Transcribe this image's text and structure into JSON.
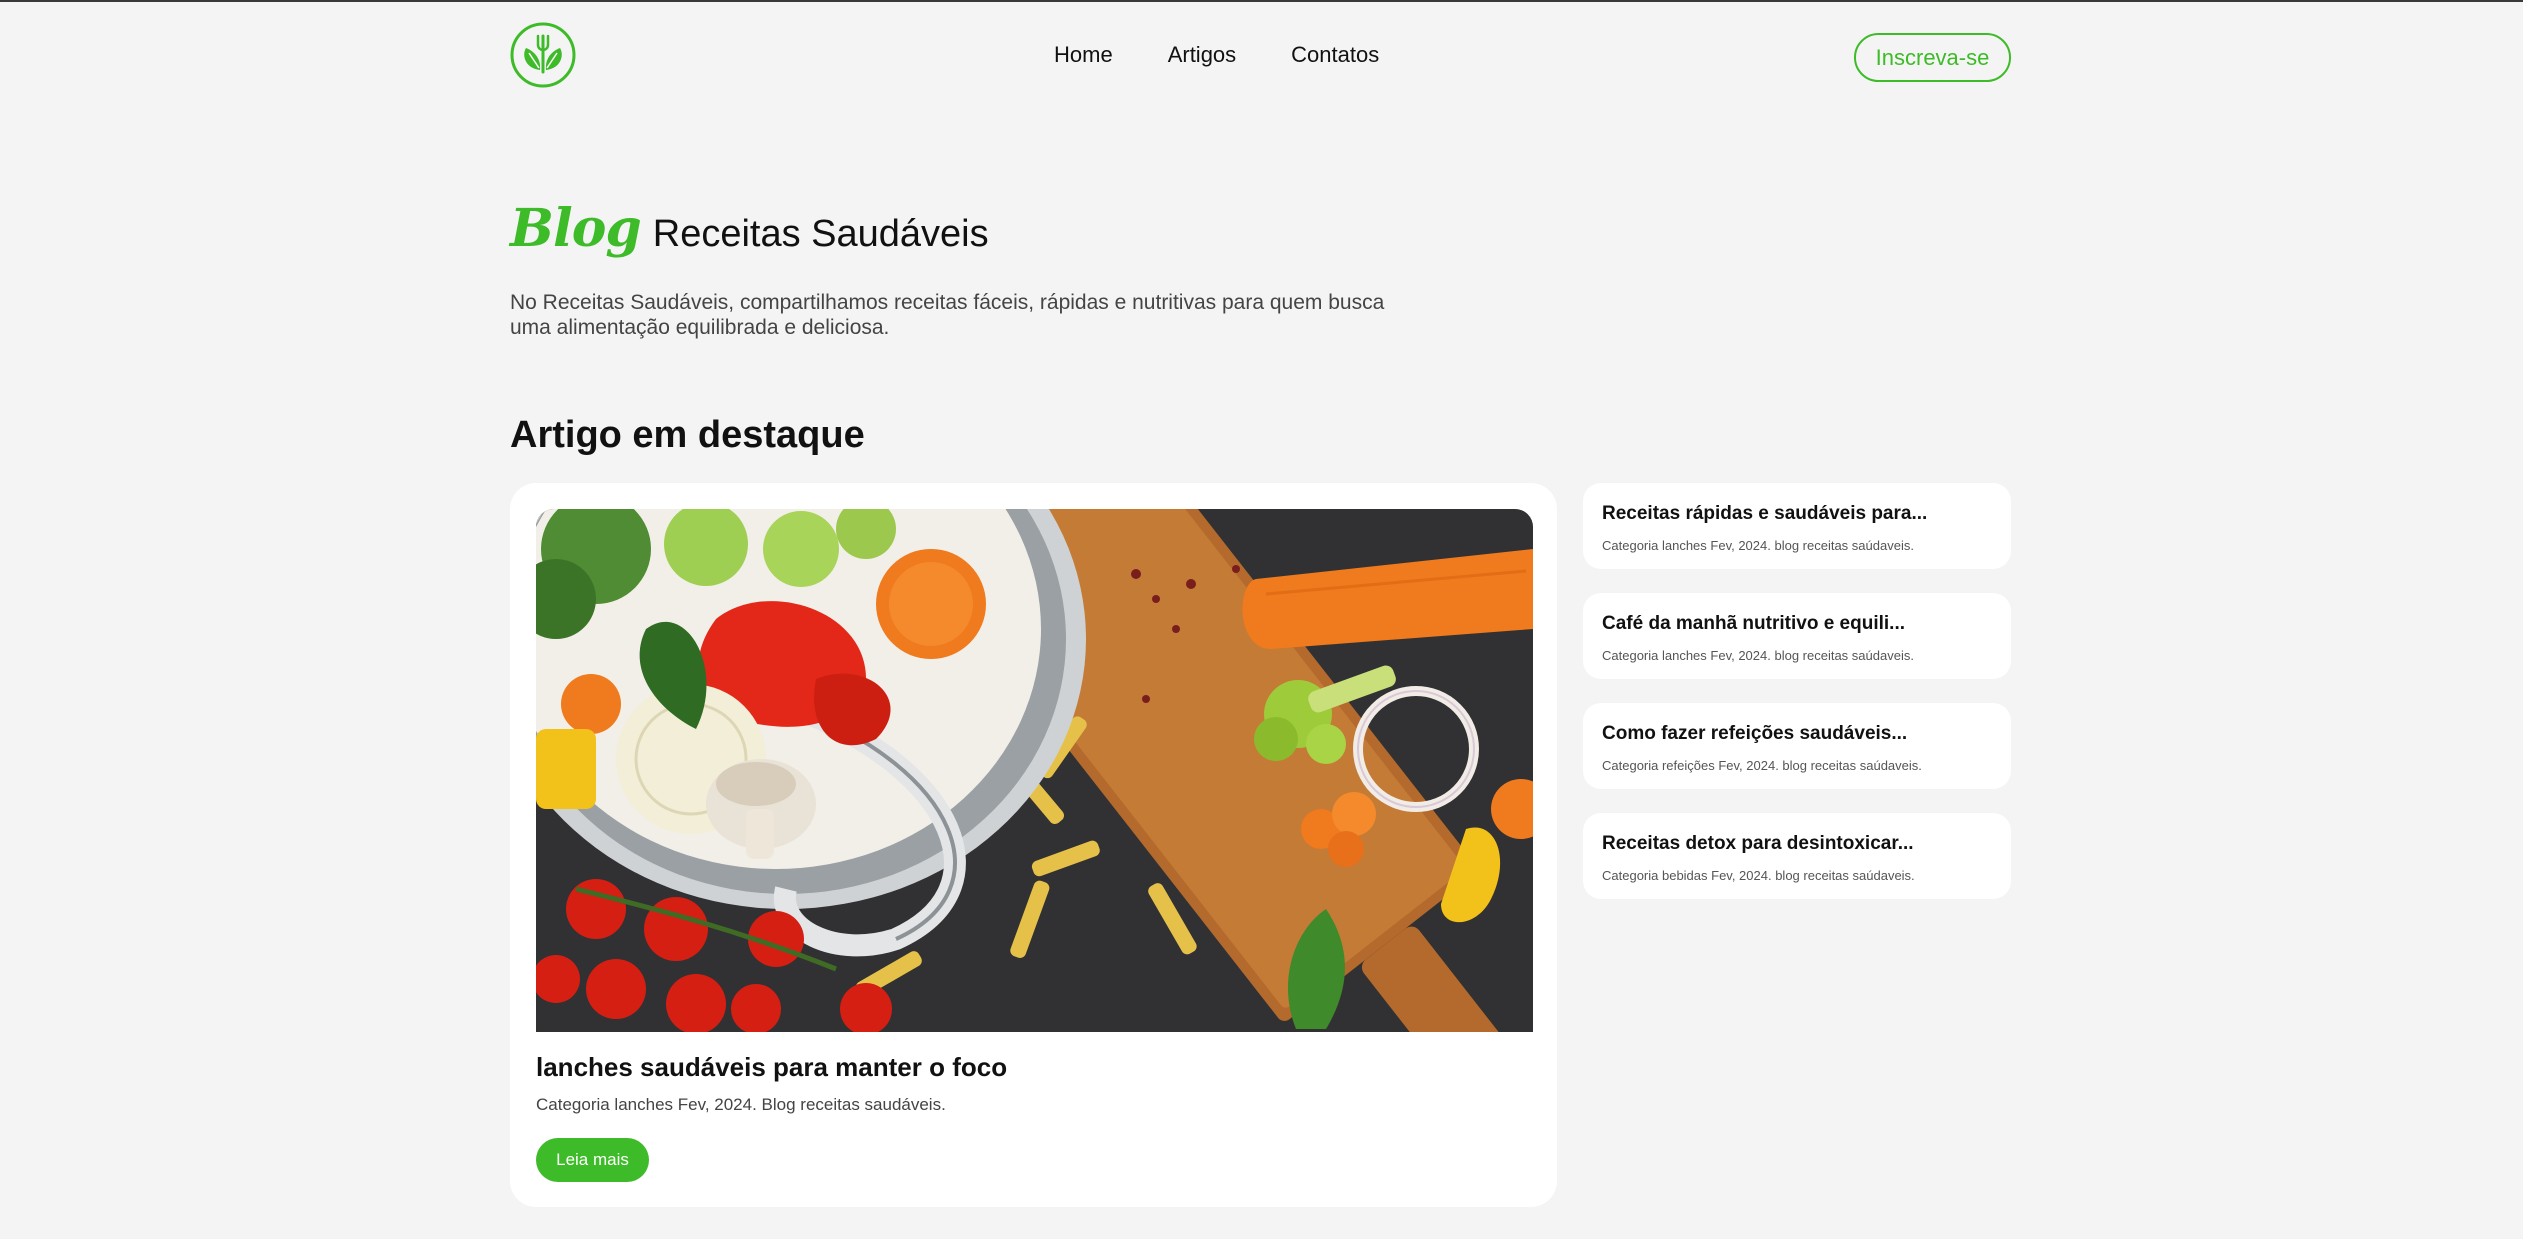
{
  "header": {
    "logo_icon": "fork-leaf-logo-icon",
    "nav": [
      "Home",
      "Artigos",
      "Contatos"
    ],
    "subscribe_label": "Inscreva-se"
  },
  "hero": {
    "blog_word": "Blog",
    "title": "Receitas Saudáveis",
    "description": "No Receitas Saudáveis, compartilhamos receitas fáceis, rápidas e nutritivas para quem busca uma alimentação equilibrada e deliciosa."
  },
  "featured_section": {
    "heading": "Artigo em destaque",
    "image_icon": "vegetables-cutting-board-photo",
    "title": "lanches saudáveis para manter o foco",
    "meta": "Categoria lanches Fev, 2024. Blog receitas saudáveis.",
    "button_label": "Leia mais"
  },
  "side_articles": [
    {
      "title": "Receitas rápidas e saudáveis para...",
      "meta": "Categoria lanches Fev, 2024. blog receitas saúdaveis."
    },
    {
      "title": "Café da manhã nutritivo e equili...",
      "meta": "Categoria lanches Fev, 2024. blog receitas saúdaveis."
    },
    {
      "title": "Como fazer refeições saudáveis...",
      "meta": "Categoria refeições Fev, 2024. blog receitas saúdaveis."
    },
    {
      "title": "Receitas detox para desintoxicar...",
      "meta": "Categoria bebidas Fev, 2024. blog receitas saúdaveis."
    }
  ],
  "colors": {
    "accent": "#3dbb28",
    "background": "#f4f4f4",
    "card": "#ffffff"
  }
}
